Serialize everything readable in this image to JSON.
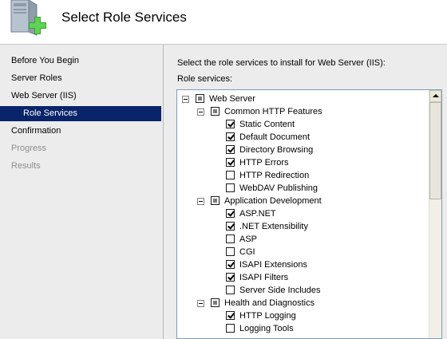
{
  "header": {
    "title": "Select Role Services"
  },
  "nav": {
    "items": [
      {
        "label": "Before You Begin"
      },
      {
        "label": "Server Roles"
      },
      {
        "label": "Web Server (IIS)"
      },
      {
        "label": "Role Services"
      },
      {
        "label": "Confirmation"
      },
      {
        "label": "Progress"
      },
      {
        "label": "Results"
      }
    ]
  },
  "main": {
    "instruction": "Select the role services to install for Web Server (IIS):",
    "services_label": "Role services:"
  },
  "tree": {
    "items": [
      {
        "label": "Web Server",
        "state": "partial"
      },
      {
        "label": "Common HTTP Features",
        "state": "partial"
      },
      {
        "label": "Static Content",
        "state": "checked"
      },
      {
        "label": "Default Document",
        "state": "checked"
      },
      {
        "label": "Directory Browsing",
        "state": "checked"
      },
      {
        "label": "HTTP Errors",
        "state": "checked"
      },
      {
        "label": "HTTP Redirection",
        "state": "unchecked"
      },
      {
        "label": "WebDAV Publishing",
        "state": "unchecked"
      },
      {
        "label": "Application Development",
        "state": "partial"
      },
      {
        "label": "ASP.NET",
        "state": "checked"
      },
      {
        "label": ".NET Extensibility",
        "state": "checked"
      },
      {
        "label": "ASP",
        "state": "unchecked"
      },
      {
        "label": "CGI",
        "state": "unchecked"
      },
      {
        "label": "ISAPI Extensions",
        "state": "checked"
      },
      {
        "label": "ISAPI Filters",
        "state": "checked"
      },
      {
        "label": "Server Side Includes",
        "state": "unchecked"
      },
      {
        "label": "Health and Diagnostics",
        "state": "partial"
      },
      {
        "label": "HTTP Logging",
        "state": "checked"
      },
      {
        "label": "Logging Tools",
        "state": "unchecked"
      }
    ]
  }
}
